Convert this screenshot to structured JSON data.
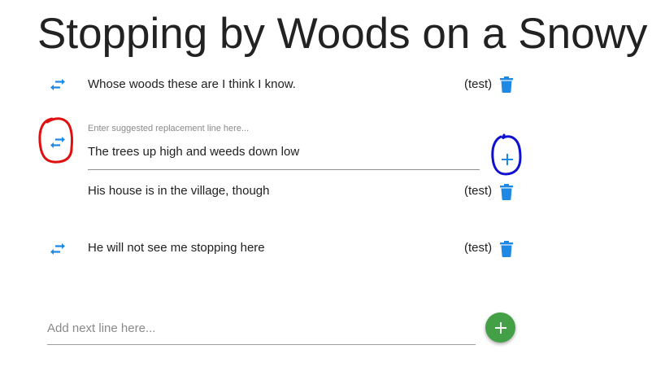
{
  "poem": {
    "title": "Stopping by Woods on a Snowy"
  },
  "lines": [
    {
      "text": "Whose woods these are I think I know.",
      "author": "(test)"
    },
    {
      "text": "His house is in the village, though",
      "author": "(test)"
    },
    {
      "text": "He will not see me stopping here",
      "author": "(test)"
    }
  ],
  "suggestion": {
    "label": "Enter suggested replacement line here...",
    "value": "The trees up high and weeds down low"
  },
  "add_line": {
    "placeholder": "Add next line here..."
  },
  "icons": {
    "swap": "swap-horiz-icon",
    "delete": "trash-icon",
    "add": "plus-icon"
  },
  "colors": {
    "accent_blue": "#1e88e5",
    "trash_blue": "#1e88e5",
    "fab_green": "#43a047",
    "annotation_red": "#e01010",
    "annotation_blue": "#1010d0"
  }
}
